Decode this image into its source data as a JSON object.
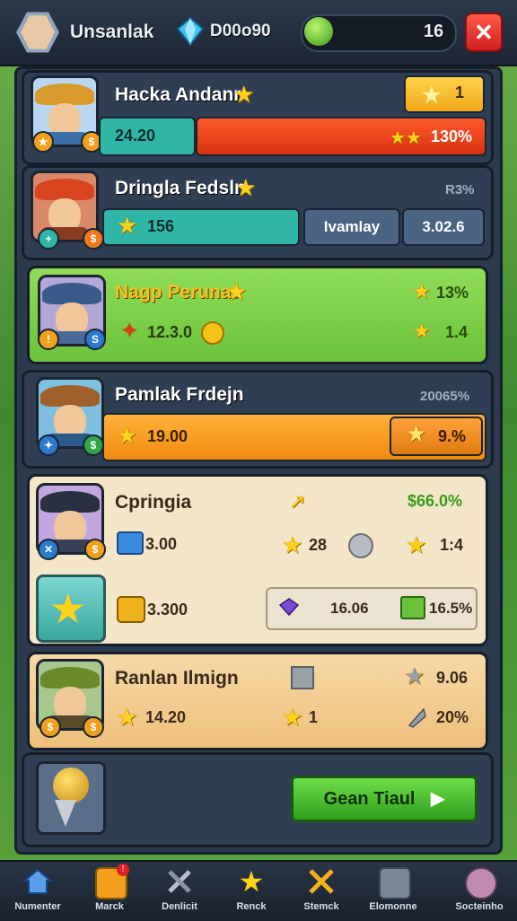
{
  "topbar": {
    "player_name": "Unsanlak",
    "currency": "D00o90",
    "level": "16",
    "close_label": "✕"
  },
  "rows": [
    {
      "name": "Hacka Andanr",
      "value_left": "24.20",
      "value_right": "130%"
    },
    {
      "name": "Dringla Fedsln",
      "top_right": "R3%",
      "value_left": "156",
      "button": "Ivamlay",
      "value_right": "3.02.6"
    },
    {
      "name": "Nagp Perunat",
      "top_right": "13%",
      "value_left": "12.3.0",
      "value_right": "1.4"
    },
    {
      "name": "Pamlak Frdejn",
      "top_right": "20065%",
      "value_left": "19.00",
      "value_right": "9.%"
    },
    {
      "name": "Cpringia",
      "top_right": "$66.0%",
      "value_left": "3.00",
      "value_mid": "28",
      "value_right": "1:4",
      "value_left2": "3.300",
      "value_box1": "16.06",
      "value_box2": "16.5%"
    },
    {
      "name": "Ranlan Ilmign",
      "value_mid_top": "9.06",
      "value_left": "14.20",
      "value_mid": "1",
      "value_right": "20%"
    }
  ],
  "claim_label": "Gean Tiaul",
  "nav": [
    {
      "label": "Numenter",
      "icon": "home-icon"
    },
    {
      "label": "Marck",
      "icon": "shop-icon"
    },
    {
      "label": "Denlicit",
      "icon": "tools-icon"
    },
    {
      "label": "Renck",
      "icon": "star-icon"
    },
    {
      "label": "Stemck",
      "icon": "swords-icon"
    },
    {
      "label": "Elomonne",
      "icon": "camera-icon"
    },
    {
      "label": "Socteinho",
      "icon": "profile-icon"
    }
  ],
  "colors": {
    "accent_red": "#e63a1a",
    "teal": "#2fb6a6",
    "orange": "#f0a01c",
    "green": "#6bc23a"
  }
}
